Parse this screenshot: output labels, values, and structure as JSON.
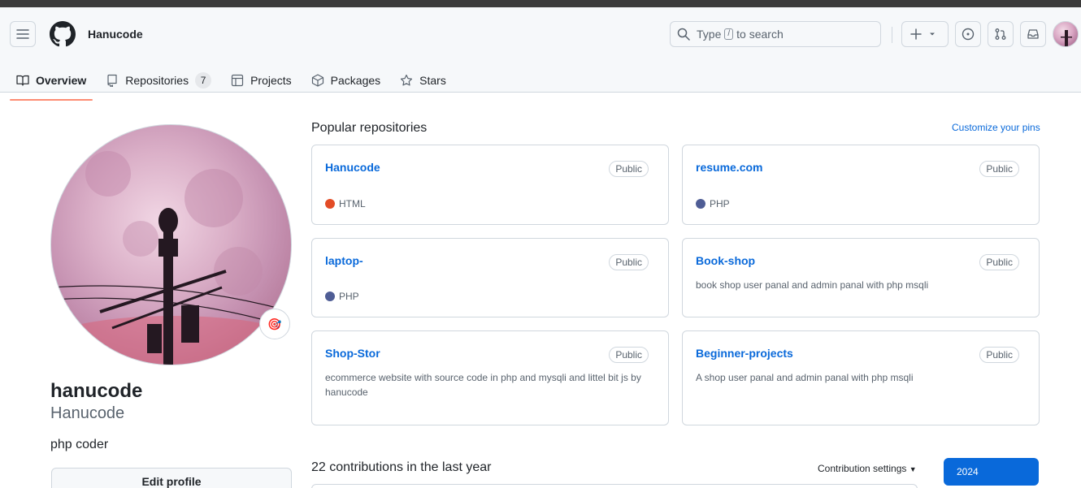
{
  "header": {
    "brand": "Hanucode",
    "search_text_before": "Type",
    "search_key": "/",
    "search_text_after": "to search"
  },
  "tabs": [
    {
      "label": "Overview",
      "icon": "book-icon"
    },
    {
      "label": "Repositories",
      "icon": "repo-icon",
      "count": "7"
    },
    {
      "label": "Projects",
      "icon": "table-icon"
    },
    {
      "label": "Packages",
      "icon": "package-icon"
    },
    {
      "label": "Stars",
      "icon": "star-icon"
    }
  ],
  "profile": {
    "name": "hanucode",
    "login": "Hanucode",
    "bio": "php coder",
    "edit_label": "Edit profile",
    "status_emoji": "🎯"
  },
  "popular": {
    "title": "Popular repositories",
    "customize_label": "Customize your pins",
    "repos": [
      {
        "name": "Hanucode",
        "visibility": "Public",
        "description": "",
        "language": "HTML",
        "lang_color": "#e34c26"
      },
      {
        "name": "resume.com",
        "visibility": "Public",
        "description": "",
        "language": "PHP",
        "lang_color": "#4F5D95"
      },
      {
        "name": "laptop-",
        "visibility": "Public",
        "description": "",
        "language": "PHP",
        "lang_color": "#4F5D95"
      },
      {
        "name": "Book-shop",
        "visibility": "Public",
        "description": "book shop user panal and admin panal with php msqli",
        "language": "",
        "lang_color": ""
      },
      {
        "name": "Shop-Stor",
        "visibility": "Public",
        "description": "ecommerce website with source code in php and mysqli and littel bit js by hanucode",
        "language": "",
        "lang_color": ""
      },
      {
        "name": "Beginner-projects",
        "visibility": "Public",
        "description": "A shop user panal and admin panal with php msqli",
        "language": "",
        "lang_color": ""
      }
    ]
  },
  "contributions": {
    "title": "22 contributions in the last year",
    "settings_label": "Contribution settings",
    "year": "2024"
  },
  "colors": {
    "accent": "#0969da",
    "tab_underline": "#fd8c73"
  }
}
